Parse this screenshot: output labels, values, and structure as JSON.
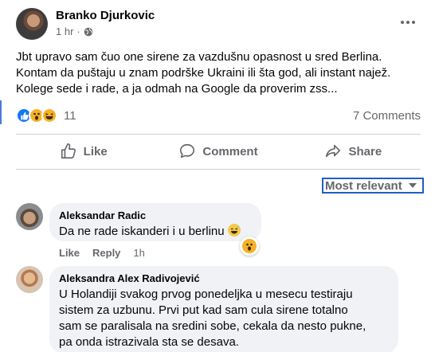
{
  "post": {
    "author": "Branko Djurkovic",
    "time": "1 hr",
    "separator": "·",
    "privacy_icon": "globe-icon",
    "text_lines": [
      "Jbt upravo sam čuo one sirene za vazdušnu opasnost u sred Berlina.",
      "Kontam da puštaju u znam podrške Ukraini ili šta god, ali instant najež.",
      "Kolege sede i rade, a ja odmah na Google da proverim zss..."
    ],
    "reactions": {
      "types": [
        "like",
        "wow",
        "haha"
      ],
      "count": "11"
    },
    "comments_count": "7 Comments"
  },
  "actions": {
    "like": "Like",
    "comment": "Comment",
    "share": "Share"
  },
  "sort": {
    "label": "Most relevant"
  },
  "comments": [
    {
      "author": "Aleksandar Radic",
      "text": "Da ne rade iskanderi i u berlinu",
      "inline_emoji": "grinning-sweat-emoji",
      "reaction": "wow",
      "like_label": "Like",
      "reply_label": "Reply",
      "time": "1h"
    },
    {
      "author": "Aleksandra Alex Radivojević",
      "text_lines": [
        "U Holandiji svakog prvog ponedeljka u mesecu testiraju",
        "sistem za uzbunu. Prvi put kad sam cula sirene totalno",
        "sam se paralisala na sredini sobe, cekala da nesto pukne,",
        "pa onda istrazivala sta se desava."
      ]
    }
  ],
  "colors": {
    "accent": "#1877f2",
    "secondary_text": "#65676b",
    "bubble_bg": "#f0f2f5",
    "focus_outline": "#1f5fc4"
  }
}
